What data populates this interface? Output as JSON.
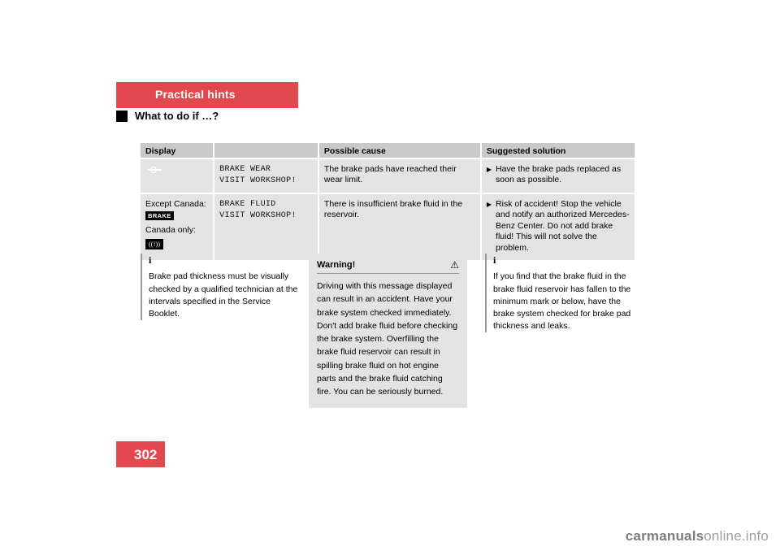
{
  "header": {
    "chapter": "Practical hints",
    "subtitle": "What to do if …?"
  },
  "table": {
    "headers": {
      "display": "Display",
      "cause": "Possible cause",
      "solution": "Suggested solution"
    },
    "rows": [
      {
        "symbol_names": [
          "brake-pad-wear-icon"
        ],
        "display_label": "",
        "display_text_line1": "BRAKE WEAR",
        "display_text_line2": "VISIT WORKSHOP!",
        "cause": "The brake pads have reached their wear limit.",
        "solution_bullet": "▶",
        "solution": "Have the brake pads replaced as soon as possible."
      },
      {
        "symbol_names": [
          "brake-icon",
          "parking-brake-icon"
        ],
        "display_label": "Except Canada:",
        "display_label2": "Canada only:",
        "brake_symbol_text": "BRAKE",
        "paren_symbol_text": "((!))",
        "display_text_line1": "BRAKE FLUID",
        "display_text_line2": "VISIT WORKSHOP!",
        "cause": "There is insufficient brake fluid in the reservoir.",
        "solution_bullet": "▶",
        "solution": "Risk of accident! Stop the vehicle and notify an authorized Mercedes-Benz Center. Do not add brake fluid! This will not solve the problem."
      }
    ]
  },
  "notes": {
    "left": {
      "icon": "i",
      "text": "Brake pad thickness must be visually checked by a qualified technician at the intervals specified in the Service Booklet."
    },
    "right": {
      "icon": "i",
      "text": "If you find that the brake fluid in the brake fluid reservoir has fallen to the minimum mark or below, have the brake system checked for brake pad thickness and leaks."
    }
  },
  "warning": {
    "title": "Warning!",
    "icon": "warning-triangle-icon",
    "icon_glyph": "⚠",
    "text": "Driving with this message displayed can result in an accident. Have your brake system checked immediately. Don't add brake fluid before checking the brake system. Overfilling the brake fluid reservoir can result in spilling brake fluid on hot engine parts and the brake fluid catching fire. You can be seriously burned."
  },
  "page_number": "302",
  "watermark": {
    "part1": "carmanuals",
    "part2": "online.info"
  },
  "colors": {
    "accent": "#e1494f",
    "table_header": "#c9c9c9",
    "table_cell": "#e3e3e3",
    "rule": "#9a9a9a"
  }
}
